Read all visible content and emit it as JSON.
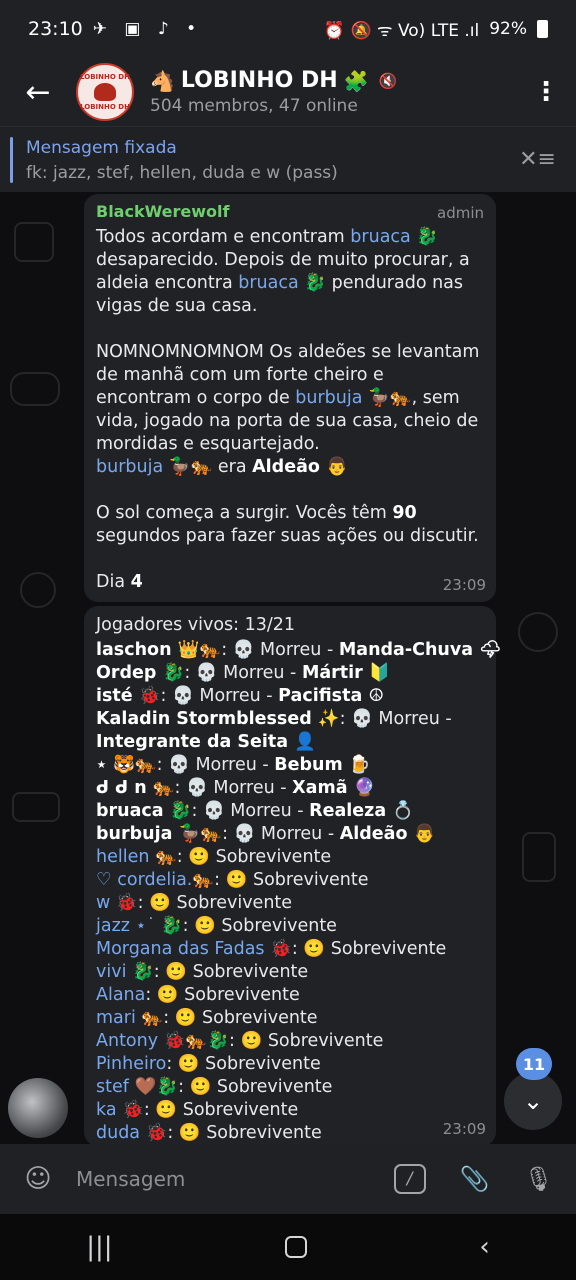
{
  "statusbar": {
    "time": "23:10",
    "left_icons": "✈ ▣ ♪ •",
    "right_icons": "⏰ 🔕 ᯤ Vo) LTE .ıl",
    "battery": "92%"
  },
  "header": {
    "back_icon": "←",
    "avatar_top": "LOBINHO DH",
    "avatar_bottom": "LOBINHO DH",
    "title_prefix_emoji": "🐴",
    "title": "LOBINHO DH",
    "title_suffix_emoji": "🧩",
    "subtitle": "504 membros, 47 online",
    "menu_icon": "⋮"
  },
  "pinned": {
    "title": "Mensagem fixada",
    "text": "fk: jazz, stef, hellen, duda e w (pass)",
    "icon": "✕≡"
  },
  "message1": {
    "sender": "BlackWerewolf",
    "role": "admin",
    "p1a": "Todos acordam e encontram ",
    "p1_mention1": "bruaca 🐉",
    "p1b": " desaparecido. Depois de muito procurar, a aldeia encontra ",
    "p1_mention2": "bruaca 🐉",
    "p1c": " pendurado nas vigas de sua casa.",
    "p2a": "NOMNOMNOMNOM Os aldeões se levantam de manhã com um forte cheiro e encontram o corpo de ",
    "p2_mention": "burbuja 🦆🐅",
    "p2b": ", sem vida, jogado na porta de sua casa, cheio de mordidas e esquartejado.",
    "p3_mention": "burbuja 🦆🐅",
    "p3_text": " era ",
    "p3_role": "Aldeão 👨",
    "p4a": "O sol começa a surgir. Vocês têm ",
    "p4_bold": "90",
    "p4b": " segundos para fazer suas ações ou discutir.",
    "p5a": "Dia ",
    "p5_bold": "4",
    "time": "23:09"
  },
  "message2": {
    "header": "Jogadores vivos: 13/21",
    "dead": [
      {
        "name": "laschon 👑🐅",
        "status": ": 💀 Morreu - ",
        "role": "Manda-Chuva 🌩"
      },
      {
        "name": "Ordep 🐉",
        "status": ": 💀 Morreu - ",
        "role": "Mártir 🔰"
      },
      {
        "name": "isté 🐞",
        "status": ": 💀 Morreu - ",
        "role": "Pacifista ☮"
      },
      {
        "name": "Kaladin Stormblessed ✨",
        "status": ": 💀 Morreu -",
        "role": ""
      },
      {
        "name": "",
        "status": "",
        "role": "Integrante da Seita 👤"
      },
      {
        "name": "⋆ 🐯🐅",
        "status": ": 💀 Morreu - ",
        "role": "Bebum 🍺"
      },
      {
        "name": "ᑯ ᑯ n 🐅",
        "status": ": 💀 Morreu - ",
        "role": "Xamã 🔮"
      },
      {
        "name": "bruaca 🐉",
        "status": ": 💀 Morreu - ",
        "role": "Realeza 💍"
      },
      {
        "name": "burbuja 🦆🐅",
        "status": ": 💀 Morreu - ",
        "role": "Aldeão 👨"
      }
    ],
    "alive": [
      {
        "name": "hellen 🐅",
        "status": ": 🙂 Sobrevivente"
      },
      {
        "name": "♡ cordelia.🐅",
        "status": ": 🙂 Sobrevivente"
      },
      {
        "name": "w 🐞",
        "status": ": 🙂 Sobrevivente"
      },
      {
        "name": "jazz ⋆˙ 🐉",
        "status": ": 🙂 Sobrevivente"
      },
      {
        "name": "Morgana das Fadas 🐞",
        "status": ": 🙂 Sobrevivente"
      },
      {
        "name": "vivi 🐉",
        "status": ": 🙂 Sobrevivente"
      },
      {
        "name": "Alana",
        "status": ": 🙂 Sobrevivente"
      },
      {
        "name": "mari 🐅",
        "status": ": 🙂 Sobrevivente"
      },
      {
        "name": "Antony 🐞🐅🐉",
        "status": ": 🙂 Sobrevivente"
      },
      {
        "name": "Pinheiro",
        "status": ": 🙂 Sobrevivente"
      },
      {
        "name": "stef 🤎🐉",
        "status": ": 🙂 Sobrevivente"
      },
      {
        "name": "ka 🐞",
        "status": ": 🙂 Sobrevivente"
      },
      {
        "name": "duda 🐞",
        "status": ": 🙂 Sobrevivente"
      }
    ],
    "time": "23:09"
  },
  "scroll": {
    "icon": "⌄",
    "unread": "11"
  },
  "inputbar": {
    "emoji_icon": "☺",
    "placeholder": "Mensagem",
    "slash_icon": "/",
    "attach_icon": "📎",
    "mic_icon": "🎙"
  },
  "navbar": {
    "recent_icon": "|||",
    "back_icon": "‹"
  },
  "colors": {
    "accent": "#78a8ee",
    "admin_name": "#6fcf6e",
    "bubble": "#212226",
    "badge": "#5b8fe4"
  }
}
